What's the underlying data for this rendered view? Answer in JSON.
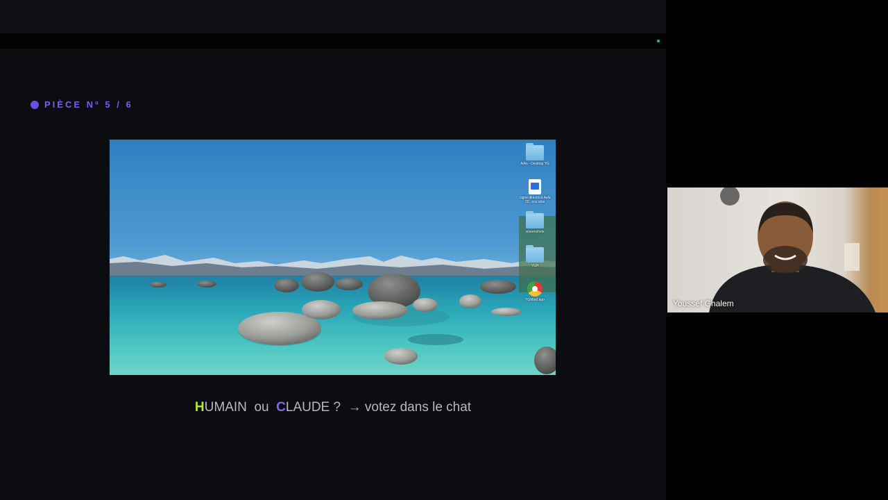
{
  "slide": {
    "piece_label": "PIÈCE Nº 5 / 6",
    "caption": {
      "h_letter": "H",
      "h_rest": "UMAIN",
      "ou": "  ou  ",
      "c_letter": "C",
      "c_rest": "LAUDE ?",
      "arrow": "  → ",
      "vote": "votez dans le chat"
    },
    "colors": {
      "accent_purple": "#7a5cf0",
      "accent_green": "#b6e636",
      "background": "#0c0d10"
    }
  },
  "desktop": {
    "icons": [
      {
        "label": "AIAs - Desktop YG",
        "icon": "folder-icon"
      },
      {
        "label": "Ligne directrice Aels 20...ocs alos",
        "icon": "document-icon"
      },
      {
        "label": "screenshots",
        "icon": "folder-icon"
      },
      {
        "label": "YGH",
        "icon": "folder-icon"
      },
      {
        "label": "YGMind app",
        "icon": "app-icon"
      }
    ]
  },
  "participant": {
    "name": "Youssef Ghalem"
  }
}
